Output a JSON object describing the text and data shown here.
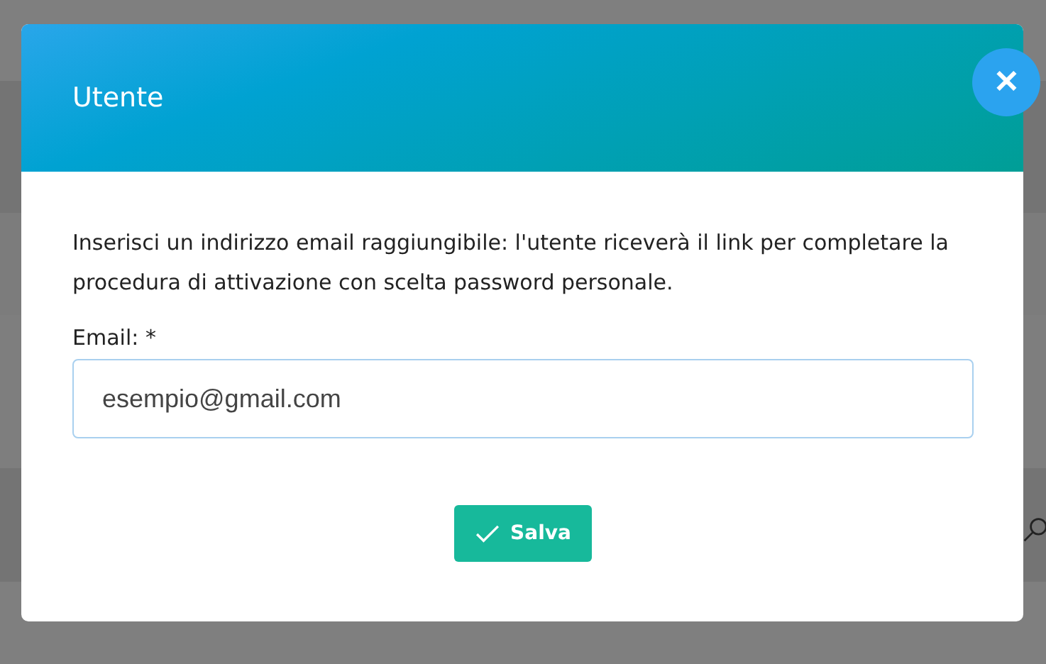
{
  "modal": {
    "title": "Utente",
    "close": "✕",
    "message": "Inserisci un indirizzo email raggiungibile: l'utente riceverà il link per completare la procedura di attivazione con scelta password personale.",
    "email_label": "Email: *",
    "email_value": "esempio@gmail.com",
    "save_button": "Salva"
  }
}
